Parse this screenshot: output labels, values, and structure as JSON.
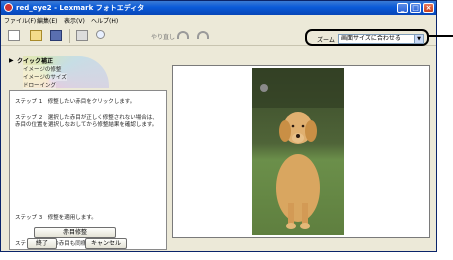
{
  "window": {
    "title": "red_eye2 - Lexmark フォトエディタ"
  },
  "menu": [
    "ファイル(F)",
    "編集(E)",
    "表示(V)",
    "ヘルプ(H)"
  ],
  "toolbar": {
    "undo_label": "やり直し"
  },
  "zoom": {
    "label": "ズーム",
    "value": "画面サイズに合わせる"
  },
  "panel": {
    "title": "クイック補正",
    "items": [
      "イメージの修整",
      "イメージのサイズ",
      "ドローイング"
    ]
  },
  "steps": {
    "step1": "ステップ 1　修整したい赤目をクリックします。",
    "step2": "ステップ 2　選択した赤目が正しく修整されない場合は、赤目の位置を選択しなおしてから修整結果を確認します。",
    "step3": "ステップ 3　修整を適用します。",
    "redeye_button": "赤目修整",
    "step4": "ステップ 4　他の赤目も同様に修整します。",
    "finish_button": "終了",
    "cancel_button": "キャンセル"
  },
  "colors": {
    "title_bar": "#0a5ad8",
    "callout": "#000000",
    "grass": "#6b8f4a",
    "dog": "#d9a660"
  }
}
